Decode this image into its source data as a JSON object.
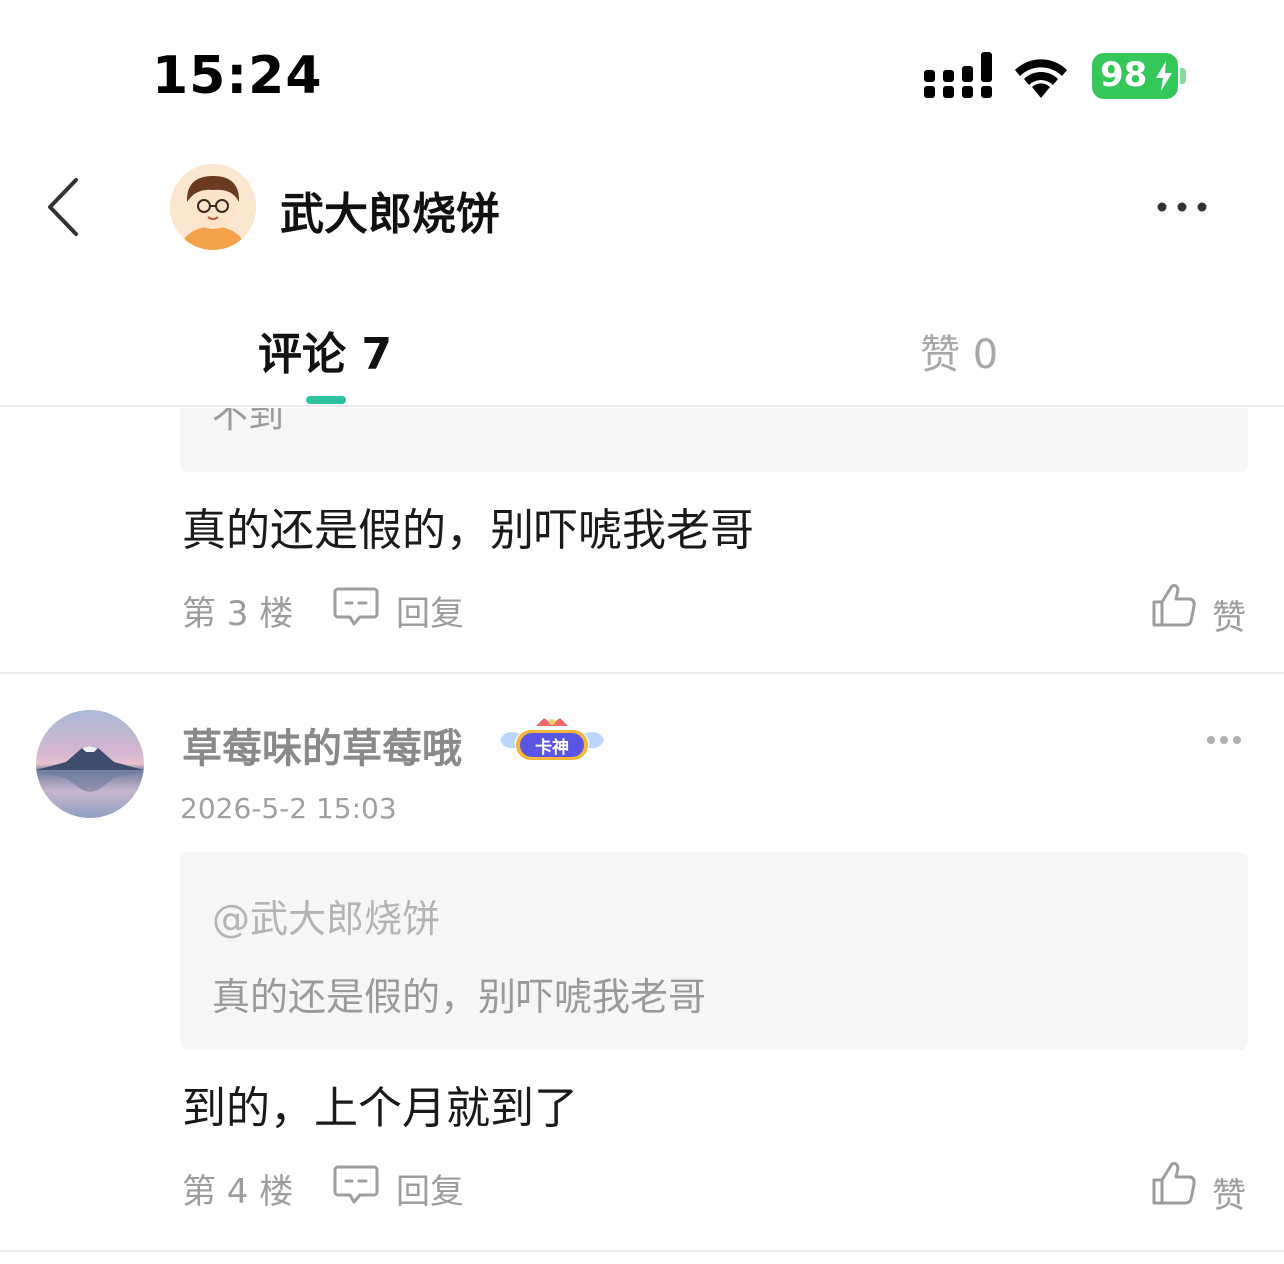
{
  "status_bar": {
    "time": "15:24",
    "battery": "98"
  },
  "header": {
    "title": "武大郎烧饼"
  },
  "tabs": {
    "comments": "评论 7",
    "likes": "赞 0"
  },
  "partial_quote": {
    "text": "不到"
  },
  "comments": [
    {
      "text": "真的还是假的，别吓唬我老哥",
      "floor": "第 3 楼",
      "reply": "回复",
      "like": "赞"
    },
    {
      "user": "草莓味的草莓哦",
      "badge": "卡神",
      "time": "2026-5-2 15:03",
      "quote_author": "@武大郎烧饼",
      "quote_text": "真的还是假的，别吓唬我老哥",
      "text": "到的，上个月就到了",
      "floor": "第 4 楼",
      "reply": "回复",
      "like": "赞"
    }
  ],
  "colors": {
    "accent": "#2dc3a1",
    "battery": "#34c759",
    "muted": "#9d9d9d"
  }
}
